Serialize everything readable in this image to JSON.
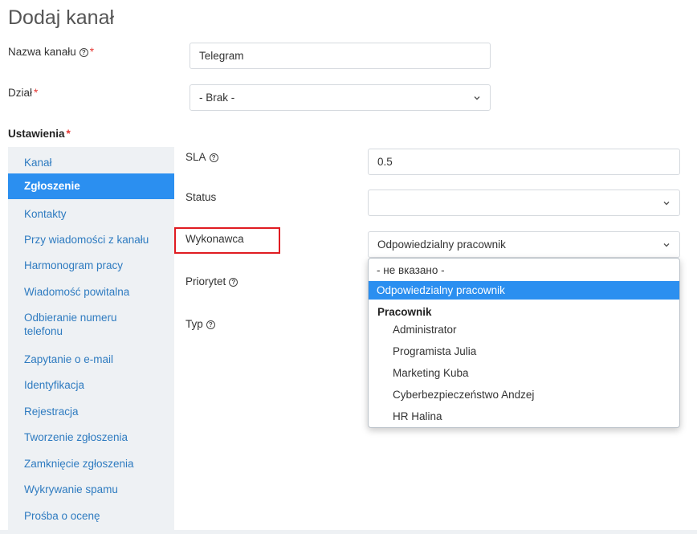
{
  "page": {
    "title": "Dodaj kanał"
  },
  "form": {
    "channel_name": {
      "label": "Nazwa kanału",
      "value": "Telegram"
    },
    "department": {
      "label": "Dział",
      "value": "- Brak -"
    },
    "required_mark": "*",
    "help_glyph": "?"
  },
  "settings": {
    "title": "Ustawienia",
    "items": [
      "Kanał",
      "Zgłoszenie",
      "Kontakty",
      "Przy wiadomości z kanału",
      "Harmonogram pracy",
      "Wiadomość powitalna",
      "Odbieranie numeru telefonu",
      "Zapytanie o e-mail",
      "Identyfikacja",
      "Rejestracja",
      "Tworzenie zgłoszenia",
      "Zamknięcie zgłoszenia",
      "Wykrywanie spamu",
      "Prośba o ocenę"
    ],
    "active_item": "Zgłoszenie"
  },
  "ticket": {
    "sla": {
      "label": "SLA",
      "value": "0.5"
    },
    "status": {
      "label": "Status",
      "value": ""
    },
    "assignee": {
      "label": "Wykonawca",
      "value": "Odpowiedzialny pracownik"
    },
    "priority": {
      "label": "Priorytet"
    },
    "type": {
      "label": "Typ"
    }
  },
  "assignee_dropdown": {
    "options": [
      {
        "label": "- не вказано -",
        "kind": "option"
      },
      {
        "label": "Odpowiedzialny pracownik",
        "kind": "option",
        "selected": true
      },
      {
        "label": "Pracownik",
        "kind": "group"
      },
      {
        "label": "Administrator",
        "kind": "suboption"
      },
      {
        "label": "Programista Julia",
        "kind": "suboption"
      },
      {
        "label": "Marketing Kuba",
        "kind": "suboption"
      },
      {
        "label": "Cyberbezpieczeństwo Andzej",
        "kind": "suboption"
      },
      {
        "label": "HR Halina",
        "kind": "suboption"
      }
    ]
  },
  "colors": {
    "accent": "#2b8ff0",
    "link": "#2e7bc0",
    "required": "#e53935",
    "highlight": "#e01c22",
    "sidebar_bg": "#eef1f4"
  }
}
